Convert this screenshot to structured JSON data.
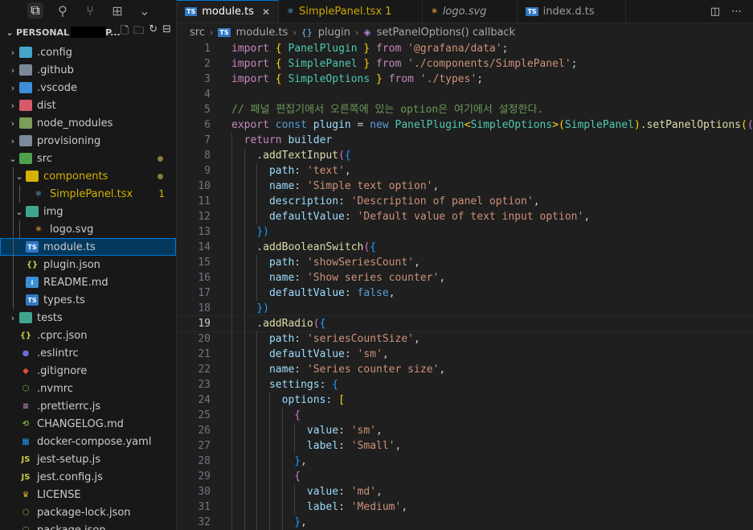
{
  "explorer": {
    "root_label": "PERSONAL",
    "root_suffix": "P...",
    "items": [
      {
        "label": ".config",
        "chev": "›",
        "depth": 0,
        "icon": "config-folder-icon",
        "color": "#43a5c8"
      },
      {
        "label": ".github",
        "chev": "›",
        "depth": 0,
        "icon": "github-folder-icon",
        "color": "#7a8a99"
      },
      {
        "label": ".vscode",
        "chev": "›",
        "depth": 0,
        "icon": "vscode-folder-icon",
        "color": "#3c8fd6"
      },
      {
        "label": "dist",
        "chev": "›",
        "depth": 0,
        "icon": "dist-folder-icon",
        "color": "#d65a6a"
      },
      {
        "label": "node_modules",
        "chev": "›",
        "depth": 0,
        "icon": "node-folder-icon",
        "color": "#7a9e5a"
      },
      {
        "label": "provisioning",
        "chev": "›",
        "depth": 0,
        "icon": "folder-icon",
        "color": "#7a8a99"
      },
      {
        "label": "src",
        "chev": "⌄",
        "depth": 0,
        "icon": "src-folder-icon",
        "color": "#4fa04f",
        "dot": true
      },
      {
        "label": "components",
        "chev": "⌄",
        "depth": 1,
        "icon": "components-folder-icon",
        "color": "#d4b106",
        "modified": true,
        "dot": true
      },
      {
        "label": "SimplePanel.tsx",
        "chev": "",
        "depth": 2,
        "icon": "react-icon",
        "color": "#d4b106",
        "modified": true,
        "badge": "1"
      },
      {
        "label": "img",
        "chev": "⌄",
        "depth": 1,
        "icon": "img-folder-icon",
        "color": "#3fa58c"
      },
      {
        "label": "logo.svg",
        "chev": "",
        "depth": 2,
        "icon": "svg-icon",
        "color": "#cccccc"
      },
      {
        "label": "module.ts",
        "chev": "",
        "depth": 1,
        "icon": "typescript-icon",
        "color": "#cccccc",
        "selected": true
      },
      {
        "label": "plugin.json",
        "chev": "",
        "depth": 1,
        "icon": "json-icon",
        "color": "#cccccc"
      },
      {
        "label": "README.md",
        "chev": "",
        "depth": 1,
        "icon": "info-icon",
        "color": "#cccccc"
      },
      {
        "label": "types.ts",
        "chev": "",
        "depth": 1,
        "icon": "typescript-icon",
        "color": "#cccccc"
      },
      {
        "label": "tests",
        "chev": "›",
        "depth": 0,
        "icon": "tests-folder-icon",
        "color": "#3fa58c"
      },
      {
        "label": ".cprc.json",
        "chev": "",
        "depth": 0,
        "icon": "json-icon",
        "color": "#cccccc"
      },
      {
        "label": ".eslintrc",
        "chev": "",
        "depth": 0,
        "icon": "eslint-icon",
        "color": "#cccccc"
      },
      {
        "label": ".gitignore",
        "chev": "",
        "depth": 0,
        "icon": "git-icon",
        "color": "#cccccc"
      },
      {
        "label": ".nvmrc",
        "chev": "",
        "depth": 0,
        "icon": "node-icon",
        "color": "#cccccc"
      },
      {
        "label": ".prettierrc.js",
        "chev": "",
        "depth": 0,
        "icon": "prettier-icon",
        "color": "#cccccc"
      },
      {
        "label": "CHANGELOG.md",
        "chev": "",
        "depth": 0,
        "icon": "changelog-icon",
        "color": "#cccccc"
      },
      {
        "label": "docker-compose.yaml",
        "chev": "",
        "depth": 0,
        "icon": "docker-icon",
        "color": "#cccccc"
      },
      {
        "label": "jest-setup.js",
        "chev": "",
        "depth": 0,
        "icon": "js-icon",
        "color": "#cccccc"
      },
      {
        "label": "jest.config.js",
        "chev": "",
        "depth": 0,
        "icon": "js-icon",
        "color": "#cccccc"
      },
      {
        "label": "LICENSE",
        "chev": "",
        "depth": 0,
        "icon": "license-icon",
        "color": "#cccccc"
      },
      {
        "label": "package-lock.json",
        "chev": "",
        "depth": 0,
        "icon": "npm-icon",
        "color": "#cccccc"
      },
      {
        "label": "package.json",
        "chev": "",
        "depth": 0,
        "icon": "npm-icon",
        "color": "#cccccc"
      }
    ]
  },
  "tabs": [
    {
      "label": "module.ts",
      "icon": "typescript-icon",
      "active": true,
      "close": "✕"
    },
    {
      "label": "SimplePanel.tsx",
      "icon": "react-icon",
      "modified": true,
      "suffix": "1"
    },
    {
      "label": "logo.svg",
      "icon": "svg-icon",
      "italic": true
    },
    {
      "label": "index.d.ts",
      "icon": "typescript-icon"
    }
  ],
  "breadcrumb": [
    "src",
    "module.ts",
    "plugin",
    "setPanelOptions() callback"
  ],
  "editor": {
    "current_line": 19,
    "lines": [
      "import { PanelPlugin } from '@grafana/data';",
      "import { SimplePanel } from './components/SimplePanel';",
      "import { SimpleOptions } from './types';",
      "",
      "// 패널 편집기에서 오른쪽에 있는 option은 여기에서 설정한다.",
      "export const plugin = new PanelPlugin<SimpleOptions>(SimplePanel).setPanelOptions((bu",
      "  return builder",
      "    .addTextInput({",
      "      path: 'text',",
      "      name: 'Simple text option',",
      "      description: 'Description of panel option',",
      "      defaultValue: 'Default value of text input option',",
      "    })",
      "    .addBooleanSwitch({",
      "      path: 'showSeriesCount',",
      "      name: 'Show series counter',",
      "      defaultValue: false,",
      "    })",
      "    .addRadio({",
      "      path: 'seriesCountSize',",
      "      defaultValue: 'sm',",
      "      name: 'Series counter size',",
      "      settings: {",
      "        options: [",
      "          {",
      "            value: 'sm',",
      "            label: 'Small',",
      "          },",
      "          {",
      "            value: 'md',",
      "            label: 'Medium',",
      "          },"
    ]
  }
}
